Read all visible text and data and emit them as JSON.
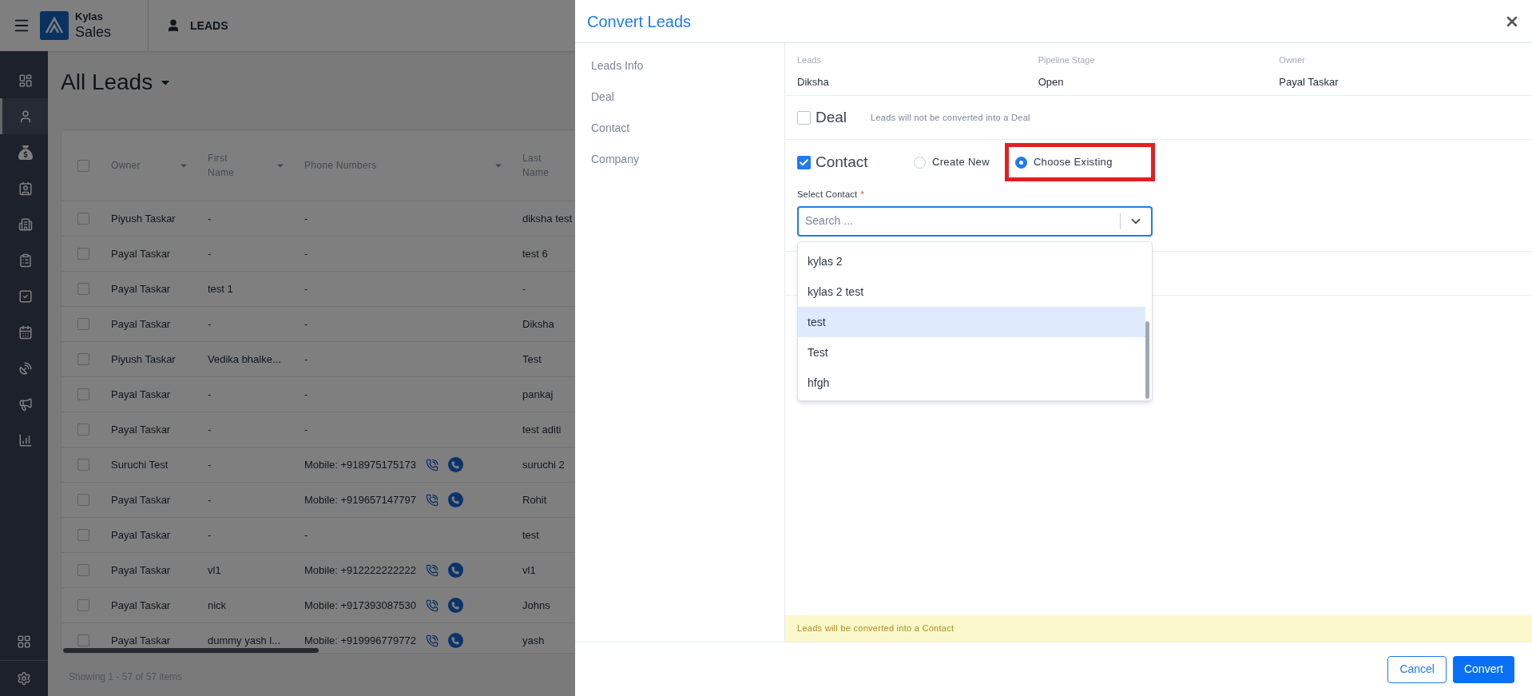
{
  "app": {
    "brand_top": "Kylas",
    "brand_bottom": "Sales",
    "module": "LEADS"
  },
  "sidebar": {
    "items": [
      {
        "selected": false
      },
      {
        "selected": true
      },
      {
        "selected": false
      },
      {
        "selected": false
      },
      {
        "selected": false
      },
      {
        "selected": false
      },
      {
        "selected": false
      },
      {
        "selected": false
      },
      {
        "selected": false
      },
      {
        "selected": false
      },
      {
        "selected": false
      }
    ]
  },
  "page": {
    "title": "All Leads",
    "table": {
      "header_checked": false,
      "columns": [
        {
          "label": "Owner"
        },
        {
          "label": "First Name"
        },
        {
          "label": "Phone Numbers"
        },
        {
          "label": "Last Name"
        }
      ],
      "rows": [
        {
          "checked": false,
          "call_actions": false,
          "cells": [
            "Piyush Taskar",
            "-",
            "-",
            "diksha test"
          ]
        },
        {
          "checked": false,
          "call_actions": false,
          "cells": [
            "Payal Taskar",
            "-",
            "-",
            "test 6"
          ]
        },
        {
          "checked": false,
          "call_actions": false,
          "cells": [
            "Payal Taskar",
            "test 1",
            "-",
            "-"
          ]
        },
        {
          "checked": false,
          "call_actions": false,
          "cells": [
            "Payal Taskar",
            "-",
            "-",
            "Diksha"
          ]
        },
        {
          "checked": false,
          "call_actions": false,
          "cells": [
            "Piyush Taskar",
            "Vedika bhalke...",
            "-",
            "Test"
          ]
        },
        {
          "checked": false,
          "call_actions": false,
          "cells": [
            "Payal Taskar",
            "-",
            "-",
            "pankaj"
          ]
        },
        {
          "checked": false,
          "call_actions": false,
          "cells": [
            "Payal Taskar",
            "-",
            "-",
            "test aditi"
          ]
        },
        {
          "checked": false,
          "call_actions": true,
          "cells": [
            "Suruchi Test",
            "-",
            "Mobile: +918975175173",
            "suruchi 2"
          ]
        },
        {
          "checked": false,
          "call_actions": true,
          "cells": [
            "Payal Taskar",
            "-",
            "Mobile: +919657147797",
            "Rohit"
          ]
        },
        {
          "checked": false,
          "call_actions": false,
          "cells": [
            "Payal Taskar",
            "-",
            "-",
            "test"
          ]
        },
        {
          "checked": false,
          "call_actions": true,
          "cells": [
            "Payal Taskar",
            "vl1",
            "Mobile: +912222222222",
            "vl1"
          ]
        },
        {
          "checked": false,
          "call_actions": true,
          "cells": [
            "Payal Taskar",
            "nick",
            "Mobile: +917393087530",
            "Johns"
          ]
        },
        {
          "checked": false,
          "call_actions": true,
          "cells": [
            "Payal Taskar",
            "dummy yash l...",
            "Mobile: +919996779772",
            "yash"
          ]
        }
      ],
      "footer": "Showing 1 - 57 of 57 items"
    }
  },
  "dialog": {
    "title": "Convert Leads",
    "nav": [
      {
        "label": "Leads Info"
      },
      {
        "label": "Deal"
      },
      {
        "label": "Contact"
      },
      {
        "label": "Company"
      }
    ],
    "summary": [
      {
        "label": "Leads",
        "value": "Diksha"
      },
      {
        "label": "Pipeline Stage",
        "value": "Open"
      },
      {
        "label": "Owner",
        "value": "Payal Taskar"
      }
    ],
    "deal": {
      "label": "Deal",
      "checked": false,
      "note": "Leads will not be converted into a Deal"
    },
    "contact": {
      "label": "Contact",
      "checked": true,
      "options": [
        {
          "label": "Create New",
          "selected": false,
          "annotated": false
        },
        {
          "label": "Choose Existing",
          "selected": true,
          "annotated": true
        }
      ],
      "field_label": "Select Contact",
      "required_mark": "*",
      "placeholder": "Search ...",
      "dropdown": [
        {
          "label": "kylas 2",
          "highlighted": false
        },
        {
          "label": "kylas 2 test",
          "highlighted": false
        },
        {
          "label": "test",
          "highlighted": true
        },
        {
          "label": "Test",
          "highlighted": false
        },
        {
          "label": "hfgh",
          "highlighted": false
        }
      ]
    },
    "banner": "Leads will be converted into a Contact",
    "buttons": [
      {
        "label": "Cancel",
        "kind": "secondary"
      },
      {
        "label": "Convert",
        "kind": "primary"
      }
    ]
  }
}
